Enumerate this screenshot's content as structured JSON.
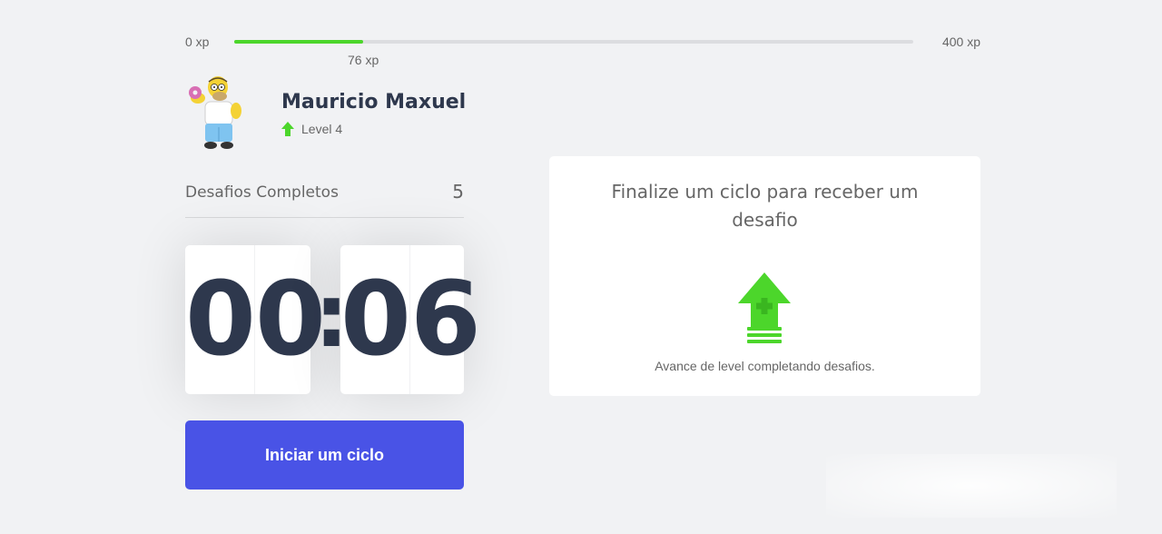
{
  "xp": {
    "min_label": "0 xp",
    "max_label": "400 xp",
    "current_label": "76 xp",
    "current_value": 76,
    "max_value": 400,
    "progress_fraction": 0.19
  },
  "profile": {
    "name": "Mauricio Maxuel",
    "level_label": "Level 4",
    "avatar_icon": "homer-simpson-avatar",
    "level_icon": "arrow-up-icon"
  },
  "challenges": {
    "label": "Desafios Completos",
    "count": "5"
  },
  "countdown": {
    "minutes_left": "0",
    "minutes_right": "0",
    "separator": ":",
    "seconds_left": "0",
    "seconds_right": "6"
  },
  "start_button": {
    "label": "Iniciar um ciclo"
  },
  "challenge_card": {
    "title": "Finalize um ciclo para receber um desafio",
    "description": "Avance de level completando desafios.",
    "icon": "level-up-icon"
  },
  "colors": {
    "accent": "#4953e6",
    "progress": "#4cd62b",
    "title": "#2e384d",
    "text": "#666666",
    "background": "#f1f2f4"
  }
}
